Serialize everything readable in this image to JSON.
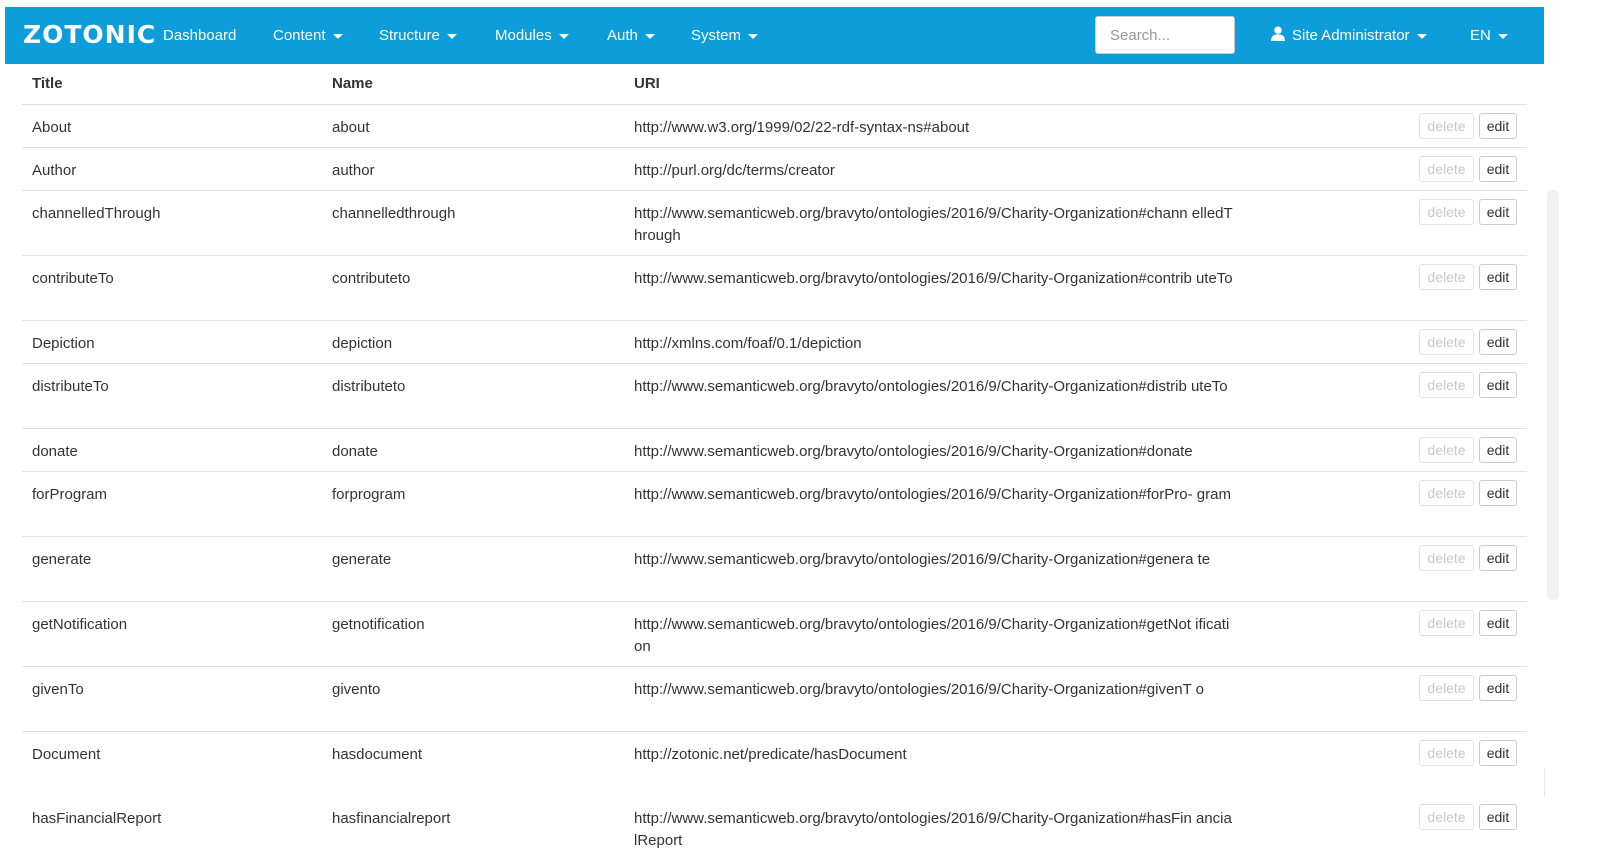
{
  "navbar": {
    "logo": "ZOTONIC",
    "items": [
      {
        "label": "Dashboard",
        "dropdown": false
      },
      {
        "label": "Content",
        "dropdown": true
      },
      {
        "label": "Structure",
        "dropdown": true
      },
      {
        "label": "Modules",
        "dropdown": true
      },
      {
        "label": "Auth",
        "dropdown": true
      },
      {
        "label": "System",
        "dropdown": true
      }
    ],
    "search_placeholder": "Search...",
    "user_label": "Site Administrator",
    "language": "EN",
    "background_color": "#0d9dda"
  },
  "table": {
    "headers": {
      "title": "Title",
      "name": "Name",
      "uri": "URI"
    },
    "delete_label": "delete",
    "edit_label": "edit",
    "rows": [
      {
        "title": "About",
        "name": "about",
        "uri": "http://www.w3.org/1999/02/22-rdf-syntax-ns#about"
      },
      {
        "title": "Author",
        "name": "author",
        "uri": "http://purl.org/dc/terms/creator"
      },
      {
        "title": "channelledThrough",
        "name": "channelledthrough",
        "uri": "http://www.semanticweb.org/bravyto/ontologies/2016/9/Charity-Organization#chann elledThrough"
      },
      {
        "title": "contributeTo",
        "name": "contributeto",
        "uri": "http://www.semanticweb.org/bravyto/ontologies/2016/9/Charity-Organization#contrib uteTo"
      },
      {
        "title": "Depiction",
        "name": "depiction",
        "uri": "http://xmlns.com/foaf/0.1/depiction"
      },
      {
        "title": "distributeTo",
        "name": "distributeto",
        "uri": "http://www.semanticweb.org/bravyto/ontologies/2016/9/Charity-Organization#distrib uteTo"
      },
      {
        "title": "donate",
        "name": "donate",
        "uri": "http://www.semanticweb.org/bravyto/ontologies/2016/9/Charity-Organization#donate"
      },
      {
        "title": "forProgram",
        "name": "forprogram",
        "uri": "http://www.semanticweb.org/bravyto/ontologies/2016/9/Charity-Organization#forPro- gram"
      },
      {
        "title": "generate",
        "name": "generate",
        "uri": "http://www.semanticweb.org/bravyto/ontologies/2016/9/Charity-Organization#genera te"
      },
      {
        "title": "getNotification",
        "name": "getnotification",
        "uri": "http://www.semanticweb.org/bravyto/ontologies/2016/9/Charity-Organization#getNot ification"
      },
      {
        "title": "givenTo",
        "name": "givento",
        "uri": "http://www.semanticweb.org/bravyto/ontologies/2016/9/Charity-Organization#givenT o"
      },
      {
        "title": "Document",
        "name": "hasdocument",
        "uri": "http://zotonic.net/predicate/hasDocument"
      },
      {
        "title": "hasFinancialReport",
        "name": "hasfinancialreport",
        "uri": "http://www.semanticweb.org/bravyto/ontologies/2016/9/Charity-Organization#hasFin ancialReport"
      }
    ]
  }
}
